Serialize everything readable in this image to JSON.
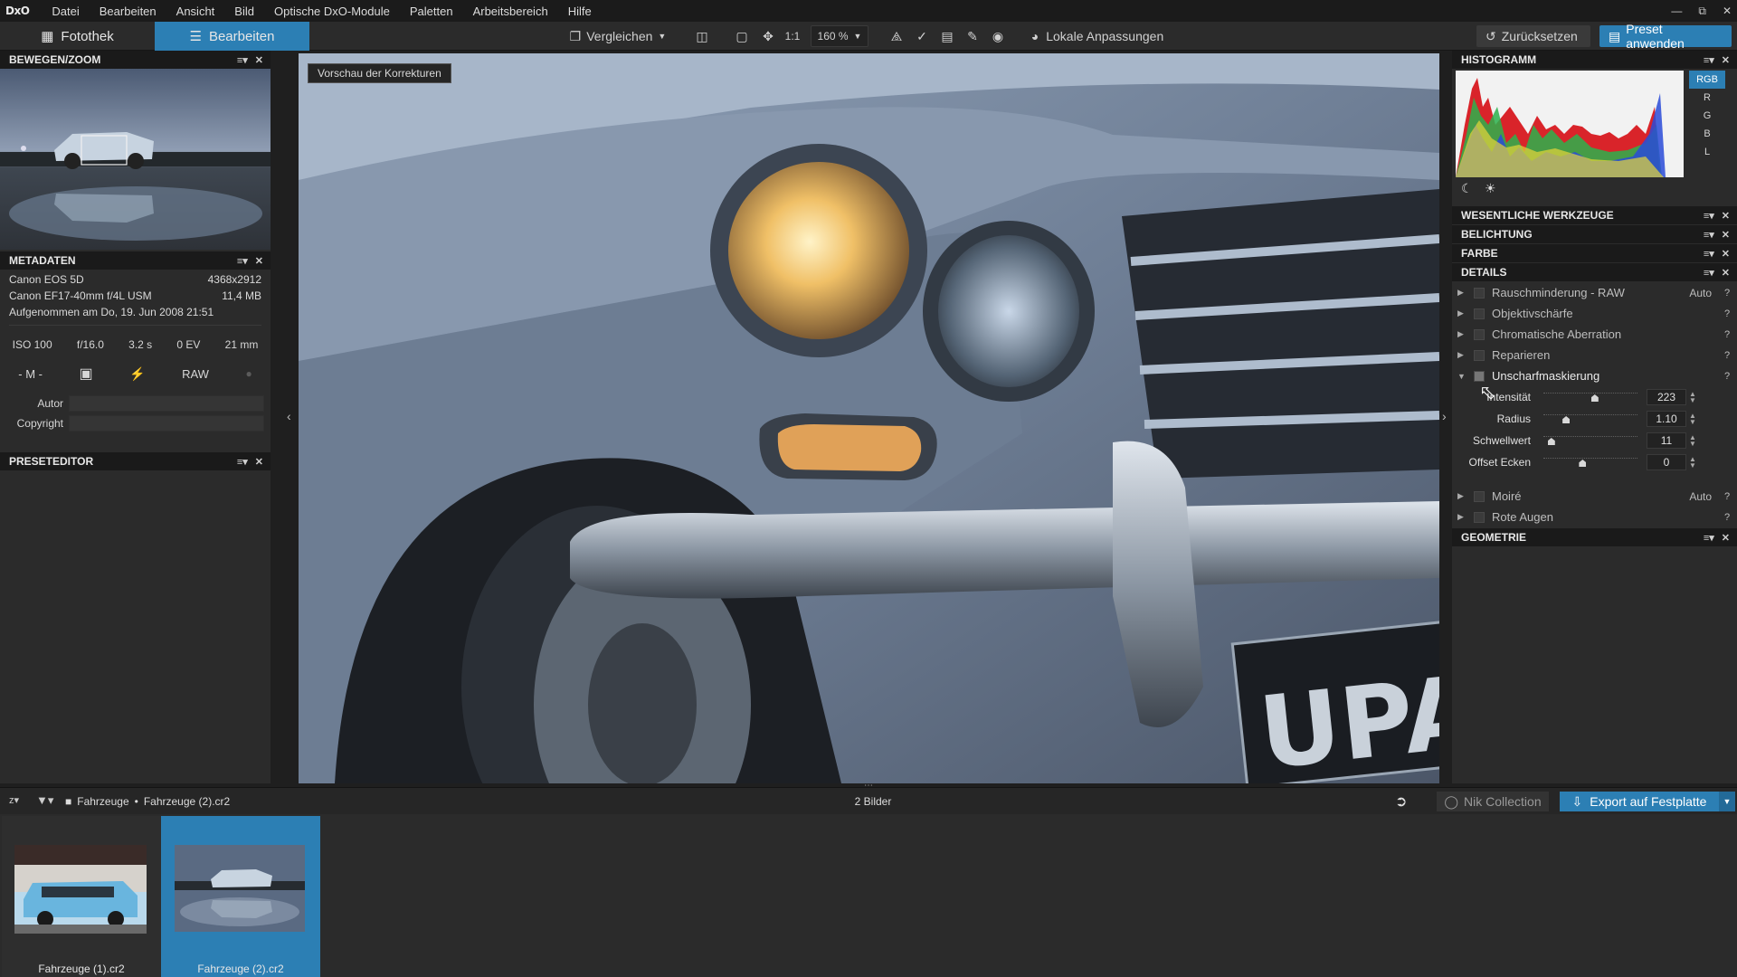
{
  "app": {
    "logo": "DxO"
  },
  "menu": [
    "Datei",
    "Bearbeiten",
    "Ansicht",
    "Bild",
    "Optische DxO-Module",
    "Paletten",
    "Arbeitsbereich",
    "Hilfe"
  ],
  "toolbar": {
    "tab_library": "Fotothek",
    "tab_edit": "Bearbeiten",
    "compare": "Vergleichen",
    "one_to_one": "1:1",
    "zoom": "160 %",
    "local_adjustments": "Lokale Anpassungen",
    "reset": "Zurücksetzen",
    "apply_preset": "Preset anwenden"
  },
  "left": {
    "navigator_title": "BEWEGEN/ZOOM",
    "metadata_title": "METADATEN",
    "camera": "Canon EOS 5D",
    "resolution": "4368x2912",
    "lens": "Canon EF17-40mm f/4L USM",
    "filesize": "11,4 MB",
    "taken": "Aufgenommen am Do, 19. Jun 2008 21:51",
    "exif": {
      "iso": "ISO 100",
      "aperture": "f/16.0",
      "shutter": "3.2 s",
      "ev": "0 EV",
      "focal": "21 mm"
    },
    "mode": "- M -",
    "format": "RAW",
    "author_label": "Autor",
    "author_value": "",
    "copyright_label": "Copyright",
    "copyright_value": "",
    "preset_editor_title": "PRESETEDITOR"
  },
  "viewer": {
    "preview_badge": "Vorschau der Korrekturen",
    "plate_text": "UPA"
  },
  "right": {
    "histogram_title": "HISTOGRAMM",
    "channels": [
      "RGB",
      "R",
      "G",
      "B",
      "L"
    ],
    "sections": {
      "essential": "WESENTLICHE WERKZEUGE",
      "exposure": "BELICHTUNG",
      "color": "FARBE",
      "details": "DETAILS",
      "geometry": "GEOMETRIE"
    },
    "details_items": [
      {
        "name": "Rauschminderung - RAW",
        "auto": "Auto",
        "help": "?"
      },
      {
        "name": "Objektivschärfe",
        "auto": "",
        "help": "?"
      },
      {
        "name": "Chromatische Aberration",
        "auto": "",
        "help": "?"
      },
      {
        "name": "Reparieren",
        "auto": "",
        "help": "?"
      },
      {
        "name": "Unscharfmaskierung",
        "auto": "",
        "help": "?"
      }
    ],
    "unsharp": [
      {
        "label": "Intensität",
        "value": "223",
        "level": 0.55
      },
      {
        "label": "Radius",
        "value": "1.10",
        "level": 0.22
      },
      {
        "label": "Schwellwert",
        "value": "11",
        "level": 0.05
      },
      {
        "label": "Offset Ecken",
        "value": "0",
        "level": 0.41
      }
    ],
    "after_items": [
      {
        "name": "Moiré",
        "auto": "Auto",
        "help": "?"
      },
      {
        "name": "Rote Augen",
        "auto": "",
        "help": "?"
      }
    ]
  },
  "bottom": {
    "sort_label": "z",
    "path_folder": "Fahrzeuge",
    "path_sep": "•",
    "path_file": "Fahrzeuge (2).cr2",
    "count": "2 Bilder",
    "nik": "Nik Collection",
    "export": "Export auf Festplatte",
    "thumbs": [
      {
        "name": "Fahrzeuge (1).cr2",
        "selected": false
      },
      {
        "name": "Fahrzeuge (2).cr2",
        "selected": true
      }
    ]
  },
  "colors": {
    "accent": "#2c7fb4",
    "panel": "#2b2b2b",
    "header": "#1a1a1a"
  }
}
